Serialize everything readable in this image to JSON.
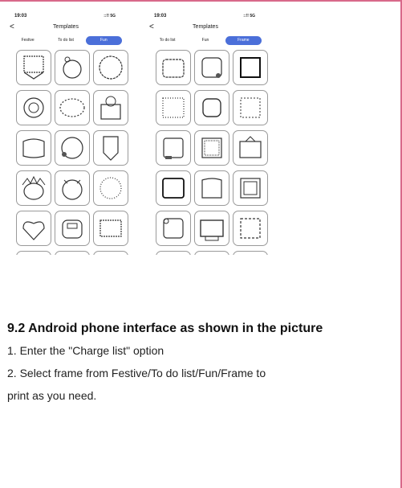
{
  "left_phone": {
    "time": "19:03",
    "signal": "::!! 5G",
    "back": "<",
    "title": "Templates",
    "tabs": [
      {
        "label": "Festive",
        "active": false
      },
      {
        "label": "To do list",
        "active": false
      },
      {
        "label": "Fun",
        "active": true
      }
    ]
  },
  "right_phone": {
    "time": "19:03",
    "signal": "::!! 5G",
    "back": "<",
    "title": "Templates",
    "tabs": [
      {
        "label": "To do list",
        "active": false
      },
      {
        "label": "Fun",
        "active": false
      },
      {
        "label": "Frame",
        "active": true
      }
    ]
  },
  "instructions": {
    "heading": "9.2 Android phone interface as shown in the picture",
    "step1": "1. Enter the \"Charge list\" option",
    "step2_line1": "2. Select frame from Festive/To do list/Fun/Frame to",
    "step2_line2": "print as you need."
  },
  "colors": {
    "accent": "#4b6fd9",
    "border": "#d8698a"
  }
}
